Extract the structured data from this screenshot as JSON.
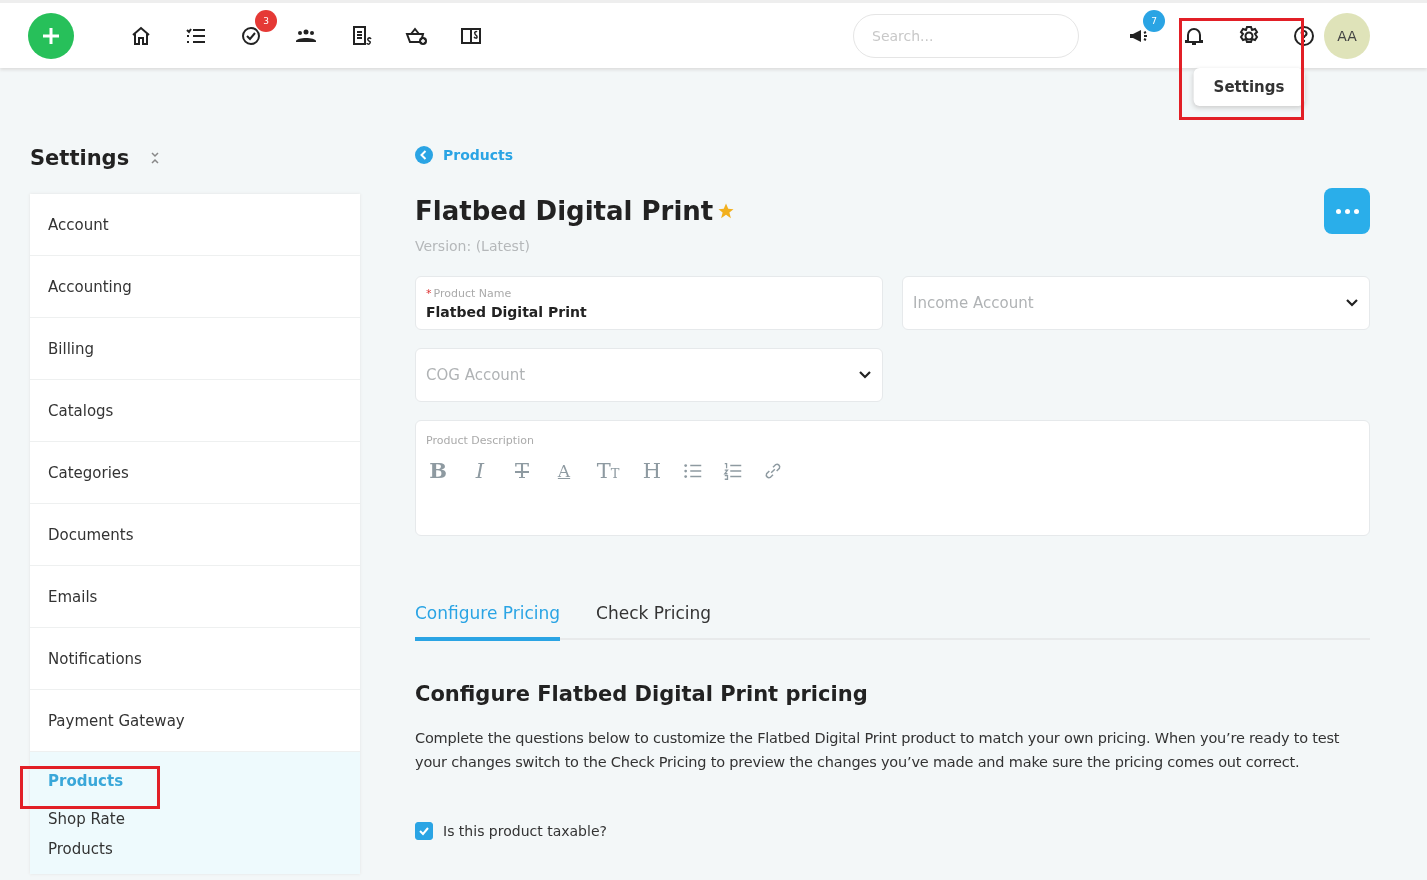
{
  "topbar": {
    "nav_icons": [
      {
        "kind": "home"
      },
      {
        "kind": "list"
      },
      {
        "kind": "check",
        "badge": "3"
      },
      {
        "kind": "people"
      },
      {
        "kind": "invoice"
      },
      {
        "kind": "basket"
      },
      {
        "kind": "book"
      }
    ],
    "search": {
      "placeholder": "Search..."
    },
    "right_icons": [
      {
        "kind": "megaphone",
        "badge": "7"
      },
      {
        "kind": "bell"
      },
      {
        "kind": "gear",
        "tooltip": "Settings"
      },
      {
        "kind": "help"
      }
    ],
    "avatar": "AA"
  },
  "sidebar": {
    "title": "Settings",
    "items": [
      {
        "label": "Account",
        "selected": false
      },
      {
        "label": "Accounting",
        "selected": false
      },
      {
        "label": "Billing",
        "selected": false
      },
      {
        "label": "Catalogs",
        "selected": false
      },
      {
        "label": "Categories",
        "selected": false
      },
      {
        "label": "Documents",
        "selected": false
      },
      {
        "label": "Emails",
        "selected": false
      },
      {
        "label": "Notifications",
        "selected": false
      },
      {
        "label": "Payment Gateway",
        "selected": false
      },
      {
        "label": "Products",
        "selected": true,
        "expanded": true,
        "children": [
          {
            "label": "Shop Rate",
            "selected": false
          },
          {
            "label": "Products",
            "selected": false
          }
        ]
      }
    ]
  },
  "breadcrumb": "Products",
  "title": "Flatbed Digital Print",
  "starred": true,
  "version": "Version: (Latest)",
  "fields": [
    {
      "kind": "text",
      "label": "Product Name",
      "required_mark": "*",
      "value": "Flatbed Digital Print"
    },
    {
      "kind": "select",
      "placeholder": "Income Account"
    },
    {
      "kind": "select",
      "placeholder": "COG Account"
    }
  ],
  "description": {
    "label": "Product Description",
    "toolbar": [
      {
        "kind": "bold",
        "glyph": "B"
      },
      {
        "kind": "italic",
        "glyph": "I"
      },
      {
        "kind": "strike",
        "glyph": "T"
      },
      {
        "kind": "color",
        "glyph": "A"
      },
      {
        "kind": "size",
        "glyph": "TT"
      },
      {
        "kind": "heading",
        "glyph": "H"
      },
      {
        "kind": "bullets"
      },
      {
        "kind": "numbers"
      },
      {
        "kind": "link"
      }
    ]
  },
  "tabs": [
    {
      "label": "Configure Pricing",
      "selected": true
    },
    {
      "label": "Check Pricing",
      "selected": false
    }
  ],
  "section_title": "Configure Flatbed Digital Print pricing",
  "section_text": "Complete the questions below to customize the Flatbed Digital Print product to match your own pricing. When you’re ready to test your changes switch to the Check Pricing to preview the changes you’ve made and make sure the pricing comes out correct.",
  "taxable": {
    "label": "Is this product taxable?",
    "checked": true
  }
}
